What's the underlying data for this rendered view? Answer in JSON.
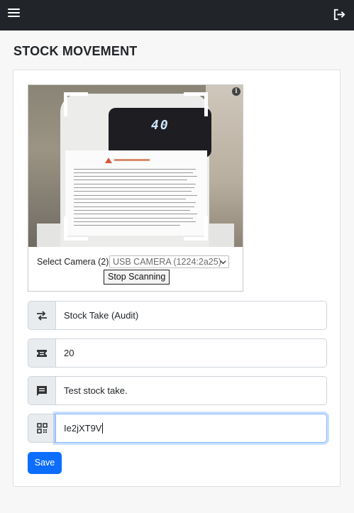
{
  "page": {
    "title": "STOCK MOVEMENT"
  },
  "topbar": {
    "menu_icon": "hamburger-menu-icon",
    "logout_icon": "logout-icon",
    "background": "#212529"
  },
  "scanner": {
    "display_reading": "40",
    "warning_heading": "Warning Tips",
    "info_icon": "info-icon",
    "camera_label": "Select Camera (2)",
    "camera_selected": "USB CAMERA (1224:2a25)",
    "stop_label": "Stop Scanning"
  },
  "form": {
    "movement_type": {
      "value": "Stock Take (Audit)",
      "icon": "transfer-arrows-icon"
    },
    "quantity": {
      "value": "20",
      "icon": "ticket-icon"
    },
    "note": {
      "value": "Test stock take.",
      "icon": "comment-icon"
    },
    "code": {
      "value": "Ie2jXT9V",
      "icon": "qr-code-icon"
    },
    "save_label": "Save"
  },
  "colors": {
    "accent": "#0d6efd",
    "focus_border": "#86b7fe",
    "addon_bg": "#e9ecef"
  }
}
